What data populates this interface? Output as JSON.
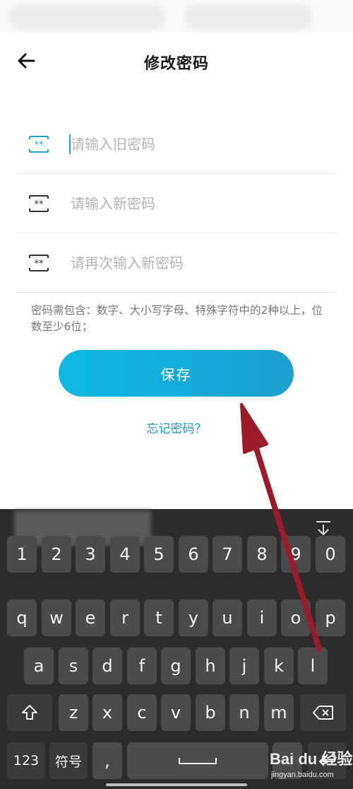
{
  "header": {
    "title": "修改密码"
  },
  "form": {
    "old_password_placeholder": "请输入旧密码",
    "new_password_placeholder": "请输入新密码",
    "confirm_password_placeholder": "请再次输入新密码",
    "field_icon_label": "**"
  },
  "hint": {
    "text": "密码需包含：数字、大小写字母、特殊字符中的2种以上，位数至少6位；"
  },
  "actions": {
    "save_label": "保存",
    "forgot_label": "忘记密码？"
  },
  "keyboard": {
    "numbers": [
      "1",
      "2",
      "3",
      "4",
      "5",
      "6",
      "7",
      "8",
      "9",
      "0"
    ],
    "row1": [
      "q",
      "w",
      "e",
      "r",
      "t",
      "y",
      "u",
      "i",
      "o",
      "p"
    ],
    "row2": [
      "a",
      "s",
      "d",
      "f",
      "g",
      "h",
      "j",
      "k",
      "l"
    ],
    "row3": [
      "z",
      "x",
      "c",
      "v",
      "b",
      "n",
      "m"
    ],
    "mode_label": "123",
    "symbols_label": "符号",
    "comma_label": ","
  },
  "watermark": {
    "brand": "Bai du 经验",
    "url": "jingyan.baidu.com"
  },
  "colors": {
    "accent": "#1fa3c8",
    "button_start": "#0fb8e4",
    "button_end": "#1c9fd0",
    "annotation_arrow": "#9b1b2a"
  },
  "icons": [
    "back-arrow-icon",
    "password-icon",
    "keyboard-hide-icon",
    "shift-icon",
    "backspace-icon",
    "space-icon",
    "enter-icon"
  ]
}
